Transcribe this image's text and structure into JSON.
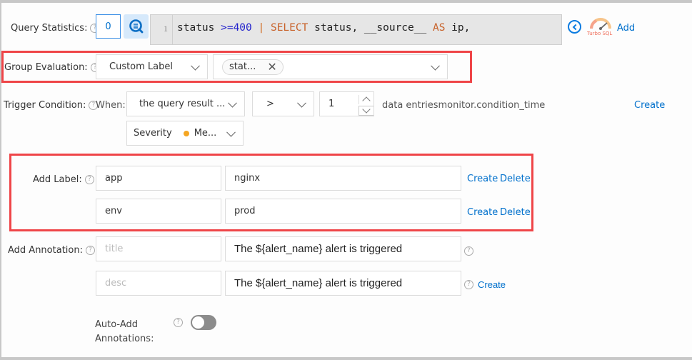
{
  "query_statistics": {
    "label": "Query Statistics:",
    "help": "?",
    "count": "0",
    "search_icon": "query-search-icon",
    "editor": {
      "line_number": "1",
      "tokens": [
        {
          "text": "status ",
          "color": "#222222"
        },
        {
          "text": ">=400",
          "color": "#2222cc"
        },
        {
          "text": " | ",
          "color": "#d2691e"
        },
        {
          "text": "SELECT",
          "color": "#c8622a"
        },
        {
          "text": " status, __source__ ",
          "color": "#222222"
        },
        {
          "text": "AS",
          "color": "#c8622a"
        },
        {
          "text": " ip,",
          "color": "#222222"
        }
      ]
    },
    "collapse_icon": "chevron-left-circle-icon",
    "turbo_sql_label": "Turbo SQL",
    "add_label": "Add"
  },
  "group_evaluation": {
    "label": "Group Evaluation:",
    "help": "?",
    "mode": "Custom Label",
    "tags": [
      "stat..."
    ]
  },
  "trigger_condition": {
    "label": "Trigger Condition:",
    "help": "?",
    "when_label": "When:",
    "subject": "the query result ...",
    "operator": ">",
    "value": "1",
    "suffix": "data entriesmonitor.condition_time",
    "create_label": "Create",
    "severity_label": "Severity",
    "severity_value": "Me...",
    "severity_color": "#f5a623"
  },
  "add_label": {
    "label": "Add Label:",
    "help": "?",
    "rows": [
      {
        "key": "app",
        "value": "nginx",
        "create": "Create",
        "delete": "Delete"
      },
      {
        "key": "env",
        "value": "prod",
        "create": "Create",
        "delete": "Delete"
      }
    ]
  },
  "add_annotation": {
    "label": "Add Annotation:",
    "help": "?",
    "rows": [
      {
        "key_placeholder": "title",
        "value": "The ${alert_name} alert is triggered"
      },
      {
        "key_placeholder": "desc",
        "value": "The ${alert_name} alert is triggered",
        "create": "Create"
      }
    ]
  },
  "auto_add": {
    "label_line1": "Auto-Add",
    "label_line2": "Annotations:",
    "help": "?",
    "enabled": false
  },
  "colors": {
    "link": "#0070cc",
    "highlight": "#ef4548"
  }
}
